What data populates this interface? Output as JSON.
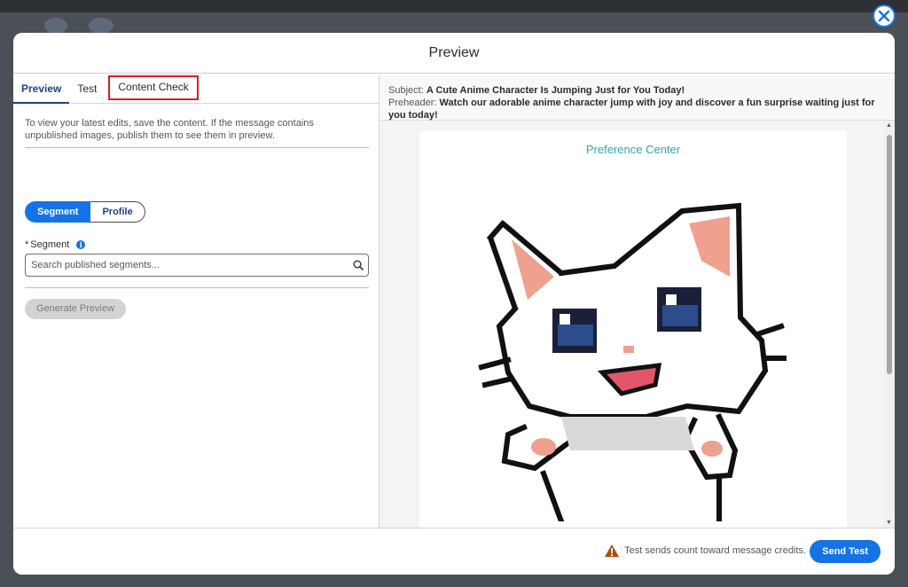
{
  "modal": {
    "title": "Preview"
  },
  "tabs": [
    {
      "label": "Preview"
    },
    {
      "label": "Test"
    },
    {
      "label": "Content Check"
    }
  ],
  "left": {
    "hint": "To view your latest edits, save the content. If the message contains unpublished images, publish them to see them in preview.",
    "toggle_segment": "Segment",
    "toggle_profile": "Profile",
    "required_mark": "*",
    "segment_label": "Segment",
    "search_placeholder": "Search published segments...",
    "generate_label": "Generate Preview"
  },
  "meta": {
    "subject_label": "Subject:",
    "subject_value": "A Cute Anime Character Is Jumping Just for You Today!",
    "preheader_label": "Preheader:",
    "preheader_value": "Watch our adorable anime character jump with joy and discover a fun surprise waiting just for you today!"
  },
  "email": {
    "preference_center": "Preference Center"
  },
  "footer": {
    "warning": "Test sends count toward message credits.",
    "send_test": "Send Test"
  },
  "colors": {
    "accent": "#1473e6",
    "highlight": "#e01b24",
    "link": "#2fa6b5",
    "warning": "#b34a0b"
  }
}
